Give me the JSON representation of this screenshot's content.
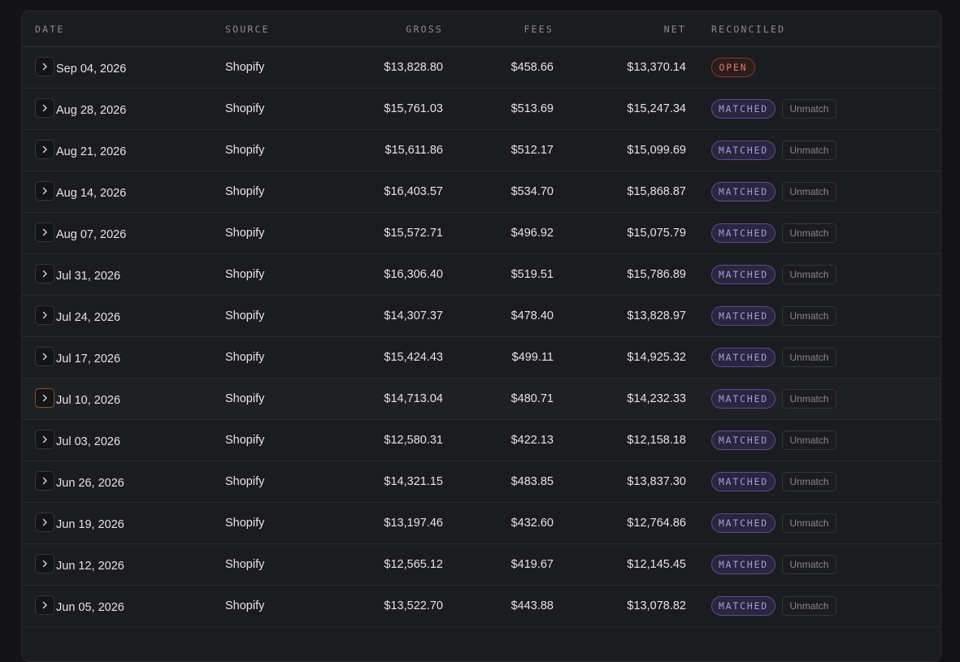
{
  "columns": {
    "date": "DATE",
    "source": "SOURCE",
    "gross": "GROSS",
    "fees": "FEES",
    "net": "NET",
    "reconciled": "RECONCILED"
  },
  "unmatch_label": "Unmatch",
  "colors": {
    "matched_badge": "#a99ad8",
    "open_badge": "#d97c6e",
    "active_expand_border": "#8a4e2b"
  },
  "rows": [
    {
      "date": "Sep 04, 2026",
      "source": "Shopify",
      "gross": "$13,828.80",
      "fees": "$458.66",
      "net": "$13,370.14",
      "status": "OPEN"
    },
    {
      "date": "Aug 28, 2026",
      "source": "Shopify",
      "gross": "$15,761.03",
      "fees": "$513.69",
      "net": "$15,247.34",
      "status": "MATCHED"
    },
    {
      "date": "Aug 21, 2026",
      "source": "Shopify",
      "gross": "$15,611.86",
      "fees": "$512.17",
      "net": "$15,099.69",
      "status": "MATCHED"
    },
    {
      "date": "Aug 14, 2026",
      "source": "Shopify",
      "gross": "$16,403.57",
      "fees": "$534.70",
      "net": "$15,868.87",
      "status": "MATCHED"
    },
    {
      "date": "Aug 07, 2026",
      "source": "Shopify",
      "gross": "$15,572.71",
      "fees": "$496.92",
      "net": "$15,075.79",
      "status": "MATCHED"
    },
    {
      "date": "Jul 31, 2026",
      "source": "Shopify",
      "gross": "$16,306.40",
      "fees": "$519.51",
      "net": "$15,786.89",
      "status": "MATCHED"
    },
    {
      "date": "Jul 24, 2026",
      "source": "Shopify",
      "gross": "$14,307.37",
      "fees": "$478.40",
      "net": "$13,828.97",
      "status": "MATCHED"
    },
    {
      "date": "Jul 17, 2026",
      "source": "Shopify",
      "gross": "$15,424.43",
      "fees": "$499.11",
      "net": "$14,925.32",
      "status": "MATCHED"
    },
    {
      "date": "Jul 10, 2026",
      "source": "Shopify",
      "gross": "$14,713.04",
      "fees": "$480.71",
      "net": "$14,232.33",
      "status": "MATCHED",
      "highlighted": true
    },
    {
      "date": "Jul 03, 2026",
      "source": "Shopify",
      "gross": "$12,580.31",
      "fees": "$422.13",
      "net": "$12,158.18",
      "status": "MATCHED"
    },
    {
      "date": "Jun 26, 2026",
      "source": "Shopify",
      "gross": "$14,321.15",
      "fees": "$483.85",
      "net": "$13,837.30",
      "status": "MATCHED"
    },
    {
      "date": "Jun 19, 2026",
      "source": "Shopify",
      "gross": "$13,197.46",
      "fees": "$432.60",
      "net": "$12,764.86",
      "status": "MATCHED"
    },
    {
      "date": "Jun 12, 2026",
      "source": "Shopify",
      "gross": "$12,565.12",
      "fees": "$419.67",
      "net": "$12,145.45",
      "status": "MATCHED"
    },
    {
      "date": "Jun 05, 2026",
      "source": "Shopify",
      "gross": "$13,522.70",
      "fees": "$443.88",
      "net": "$13,078.82",
      "status": "MATCHED"
    }
  ]
}
